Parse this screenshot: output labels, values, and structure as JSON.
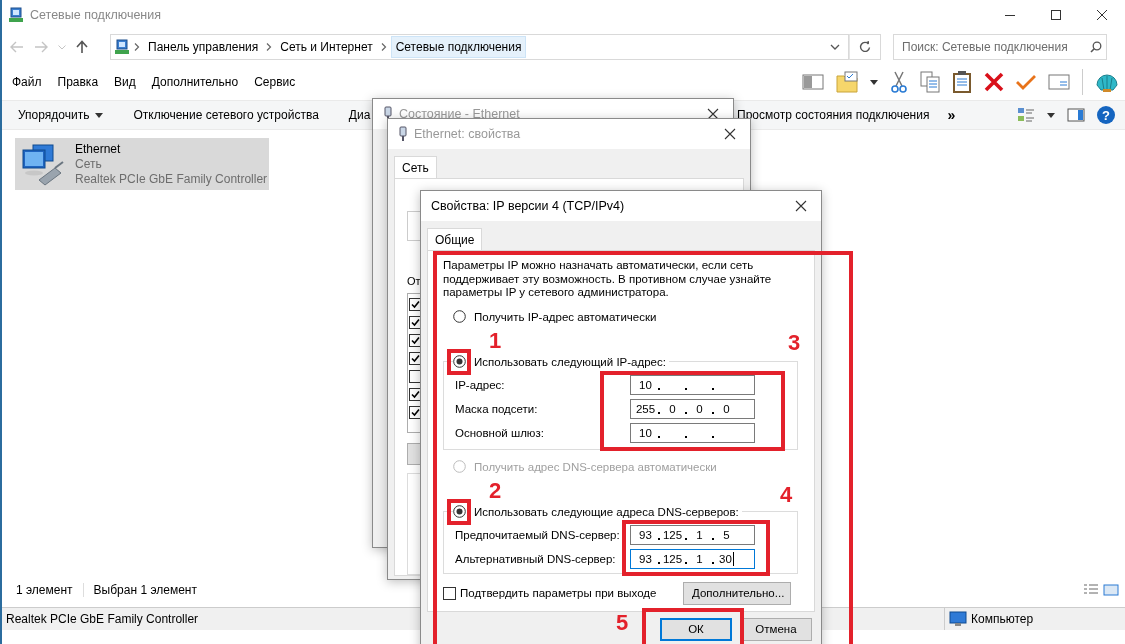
{
  "explorer": {
    "title": "Сетевые подключения",
    "breadcrumbs": [
      {
        "label": "Панель управления",
        "selected": false
      },
      {
        "label": "Сеть и Интернет",
        "selected": false
      },
      {
        "label": "Сетевые подключения",
        "selected": true
      }
    ],
    "search": {
      "placeholder": "Поиск: Сетевые подключения"
    },
    "menu": [
      "Файл",
      "Правка",
      "Вид",
      "Дополнительно",
      "Сервис"
    ],
    "commands": [
      {
        "label": "Упорядочить",
        "kind": "dropdown"
      },
      {
        "label": "Отключение сетевого устройства",
        "kind": "command"
      },
      {
        "label": "Диа",
        "kind": "command"
      }
    ],
    "commands_right": [
      {
        "label": "Просмотр состояния подключения",
        "kind": "command"
      },
      {
        "label": "»",
        "kind": "overflow"
      }
    ],
    "help": "?",
    "items": [
      {
        "name": "Ethernet",
        "type": "Сеть",
        "device": "Realtek PCIe GbE Family Controller",
        "selected": true
      }
    ],
    "status": {
      "count": "1 элемент",
      "selection": "Выбран 1 элемент"
    },
    "details_bar": {
      "text": "Realtek PCIe GbE Family Controller",
      "zone": "Компьютер"
    }
  },
  "status_dialog": {
    "title": "Состояние - Ethernet"
  },
  "properties_dialog": {
    "title": "Ethernet: свойства",
    "tabs": [
      {
        "label": "Сеть",
        "selected": true
      }
    ],
    "components_label": "От",
    "components": [
      {
        "checked": true
      },
      {
        "checked": true
      },
      {
        "checked": true
      },
      {
        "checked": true
      },
      {
        "checked": false
      },
      {
        "checked": true
      },
      {
        "checked": true
      }
    ]
  },
  "ipv4_dialog": {
    "title": "Свойства: IP версии 4 (TCP/IPv4)",
    "tabs": [
      {
        "label": "Общие",
        "selected": true
      }
    ],
    "description": "Параметры IP можно назначать автоматически, если сеть поддерживает эту возможность. В противном случае узнайте параметры IP у сетевого администратора.",
    "ip_modes": [
      {
        "label": "Получить IP-адрес автоматически",
        "selected": false,
        "disabled": false
      },
      {
        "label": "Использовать следующий IP-адрес:",
        "selected": true,
        "disabled": false
      }
    ],
    "ip_fields": [
      {
        "label": "IP-адрес:",
        "octets": [
          "10"
        ],
        "focused": false
      },
      {
        "label": "Маска подсети:",
        "octets": [
          "255",
          "0",
          "0",
          "0"
        ],
        "focused": false
      },
      {
        "label": "Основной шлюз:",
        "octets": [
          "10"
        ],
        "focused": false
      }
    ],
    "dns_modes": [
      {
        "label": "Получить адрес DNS-сервера автоматически",
        "selected": false,
        "disabled": true
      },
      {
        "label": "Использовать следующие адреса DNS-серверов:",
        "selected": true,
        "disabled": false
      }
    ],
    "dns_fields": [
      {
        "label": "Предпочитаемый DNS-сервер:",
        "octets": [
          "93",
          "125",
          "1",
          "5"
        ],
        "focused": false
      },
      {
        "label": "Альтернативный DNS-сервер:",
        "octets": [
          "93",
          "125",
          "1",
          "30"
        ],
        "focused": true
      }
    ],
    "validate": {
      "label": "Подтвердить параметры при выходе",
      "checked": false
    },
    "advanced_button": "Дополнительно...",
    "buttons": [
      {
        "label": "ОК",
        "kind": "default"
      },
      {
        "label": "Отмена",
        "kind": "normal"
      }
    ]
  },
  "annotations": [
    {
      "number": "1"
    },
    {
      "number": "2"
    },
    {
      "number": "3"
    },
    {
      "number": "4"
    },
    {
      "number": "5"
    }
  ]
}
